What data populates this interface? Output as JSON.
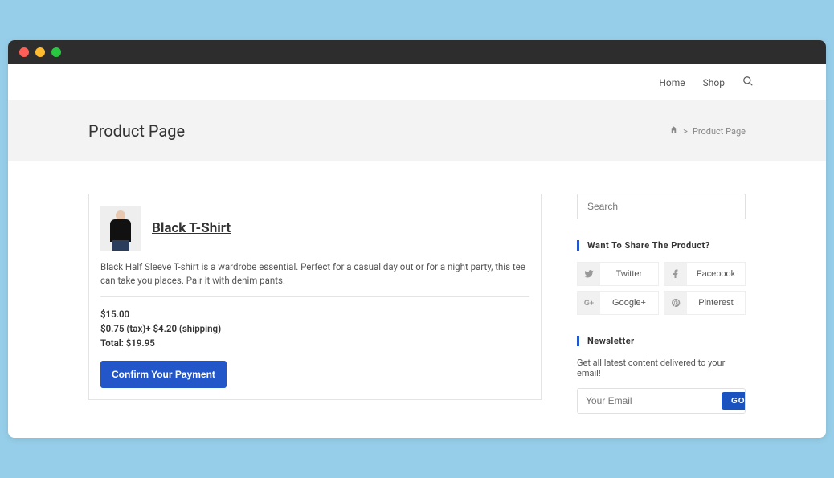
{
  "nav": {
    "home": "Home",
    "shop": "Shop"
  },
  "header": {
    "title": "Product Page",
    "breadcrumb_sep": ">",
    "breadcrumb_current": "Product Page"
  },
  "product": {
    "name": "Black T-Shirt",
    "description": "Black Half Sleeve T-shirt is a wardrobe essential. Perfect for a casual day out or for a night party, this tee can take you places. Pair it with denim pants.",
    "price_line": "$15.00",
    "fees_line": "$0.75 (tax)+ $4.20 (shipping)",
    "total_line": "Total: $19.95",
    "confirm_label": "Confirm Your Payment"
  },
  "sidebar": {
    "search_placeholder": "Search",
    "share_heading": "Want To Share The Product?",
    "share": {
      "twitter": "Twitter",
      "facebook": "Facebook",
      "google": "Google+",
      "pinterest": "Pinterest"
    },
    "newsletter_heading": "Newsletter",
    "newsletter_text": "Get all latest content delivered to your email!",
    "email_placeholder": "Your Email",
    "go_label": "GO"
  }
}
